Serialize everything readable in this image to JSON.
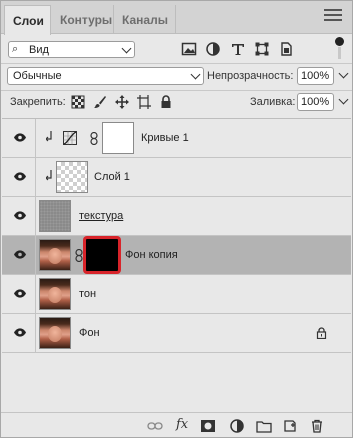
{
  "tabs": [
    {
      "label": "Слои",
      "active": true
    },
    {
      "label": "Контуры",
      "active": false
    },
    {
      "label": "Каналы",
      "active": false
    }
  ],
  "filter": {
    "value": "Вид"
  },
  "blend": {
    "mode": "Обычные",
    "opacity_label": "Непрозрачность:",
    "opacity": "100%"
  },
  "lock": {
    "label": "Закрепить:",
    "fill_label": "Заливка:",
    "fill": "100%"
  },
  "layers": [
    {
      "name": "Кривые 1",
      "type": "adjustment-curves",
      "clipped": true,
      "selected": false
    },
    {
      "name": "Слой 1",
      "type": "transparent",
      "clipped": true,
      "selected": false
    },
    {
      "name": "текстура",
      "type": "texture",
      "clipped": false,
      "selected": false
    },
    {
      "name": "Фон копия",
      "type": "photo-with-mask",
      "clipped": false,
      "selected": true
    },
    {
      "name": "тон",
      "type": "photo",
      "clipped": false,
      "selected": false
    },
    {
      "name": "Фон",
      "type": "photo",
      "locked": true,
      "selected": false
    }
  ],
  "colors": {
    "highlight": "#d8242a",
    "selected_row": "#b3b3b3"
  }
}
